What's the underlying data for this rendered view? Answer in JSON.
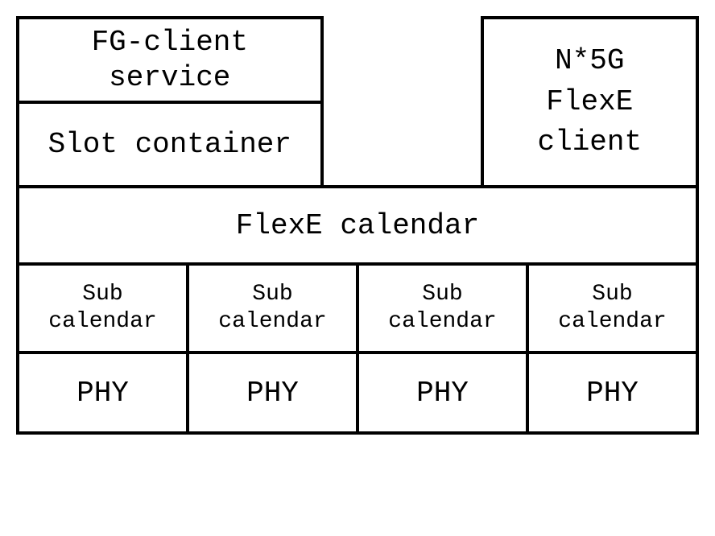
{
  "top": {
    "fg_client": "FG-client\nservice",
    "slot_container": "Slot container",
    "n5g_client": "N*5G\nFlexE\nclient"
  },
  "middle": {
    "flexe_calendar": "FlexE calendar"
  },
  "sub_calendars": [
    "Sub\ncalendar",
    "Sub\ncalendar",
    "Sub\ncalendar",
    "Sub\ncalendar"
  ],
  "phys": [
    "PHY",
    "PHY",
    "PHY",
    "PHY"
  ]
}
